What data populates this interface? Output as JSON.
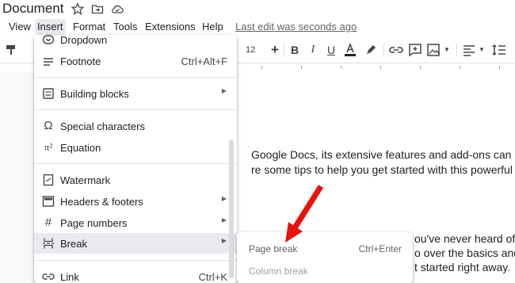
{
  "window": {
    "title": "Document",
    "icons": [
      "star-icon",
      "move-to-folder-icon",
      "cloud-status-icon"
    ]
  },
  "menubar": {
    "items": [
      "View",
      "Insert",
      "Format",
      "Tools",
      "Extensions",
      "Help"
    ],
    "active": "Insert",
    "last_edit": "Last edit was seconds ago"
  },
  "toolbar": {
    "font_size": "12",
    "text_color": "#202124"
  },
  "insert_menu": {
    "items": [
      {
        "label": "Dropdown",
        "icon": "dropdown-icon"
      },
      {
        "label": "Footnote",
        "shortcut": "Ctrl+Alt+F",
        "icon": "footnote-icon"
      },
      {
        "label": "Building blocks",
        "icon": "building-blocks-icon",
        "submenu": true
      },
      {
        "label": "Special characters",
        "icon": "omega-icon"
      },
      {
        "label": "Equation",
        "icon": "pi-squared-icon"
      },
      {
        "label": "Watermark",
        "icon": "watermark-icon"
      },
      {
        "label": "Headers & footers",
        "icon": "header-footer-icon",
        "submenu": true
      },
      {
        "label": "Page numbers",
        "icon": "hash-icon",
        "submenu": true
      },
      {
        "label": "Break",
        "icon": "break-icon",
        "submenu": true,
        "highlighted": true
      },
      {
        "label": "Link",
        "shortcut": "Ctrl+K",
        "icon": "link-icon"
      }
    ]
  },
  "break_submenu": {
    "items": [
      {
        "label": "Page break",
        "shortcut": "Ctrl+Enter"
      },
      {
        "label": "Column break",
        "disabled": true
      }
    ]
  },
  "document": {
    "lines": [
      "Google Docs, its extensive features and add-ons can",
      "re some tips to help you get started with this powerful",
      "ou've never heard of",
      "o over the basics and",
      "t started right away."
    ]
  },
  "annotation": {
    "arrow_color": "#e8120c"
  }
}
